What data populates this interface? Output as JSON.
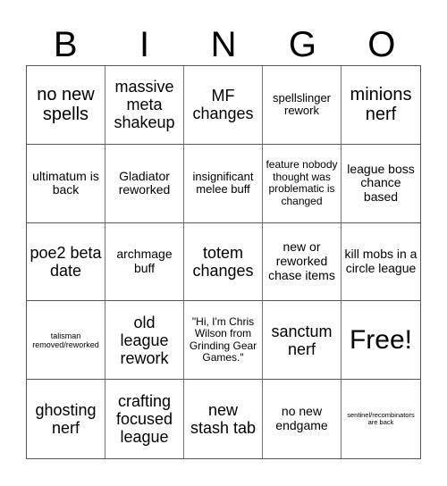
{
  "header": {
    "letters": [
      "B",
      "I",
      "N",
      "G",
      "O"
    ]
  },
  "cells": [
    {
      "text": "no new spells",
      "size": "fs-l"
    },
    {
      "text": "massive meta shakeup",
      "size": "fs-ml"
    },
    {
      "text": "MF changes",
      "size": "fs-ml"
    },
    {
      "text": "spellslinger rework",
      "size": "fs-s"
    },
    {
      "text": "minions nerf",
      "size": "fs-l"
    },
    {
      "text": "ultimatum is back",
      "size": "fs-m"
    },
    {
      "text": "Gladiator reworked",
      "size": "fs-m"
    },
    {
      "text": "insignificant melee buff",
      "size": "fs-s"
    },
    {
      "text": "feature nobody thought was problematic is changed",
      "size": "fs-xs"
    },
    {
      "text": "league boss chance based",
      "size": "fs-m"
    },
    {
      "text": "poe2 beta date",
      "size": "fs-ml"
    },
    {
      "text": "archmage buff",
      "size": "fs-m"
    },
    {
      "text": "totem changes",
      "size": "fs-ml"
    },
    {
      "text": "new or reworked chase items",
      "size": "fs-m"
    },
    {
      "text": "kill mobs in a circle league",
      "size": "fs-m"
    },
    {
      "text": "talisman removed/reworked",
      "size": "fs-xxs"
    },
    {
      "text": "old league rework",
      "size": "fs-ml"
    },
    {
      "text": "\"Hi, I'm Chris Wilson from Grinding Gear Games.\"",
      "size": "fs-xs"
    },
    {
      "text": "sanctum nerf",
      "size": "fs-ml"
    },
    {
      "text": "Free!",
      "size": "fs-xl"
    },
    {
      "text": "ghosting nerf",
      "size": "fs-ml"
    },
    {
      "text": "crafting focused league",
      "size": "fs-ml"
    },
    {
      "text": "new stash tab",
      "size": "fs-ml"
    },
    {
      "text": "no new endgame",
      "size": "fs-m"
    },
    {
      "text": "sentinel/recombinators are back",
      "size": "fs-tiny"
    }
  ]
}
